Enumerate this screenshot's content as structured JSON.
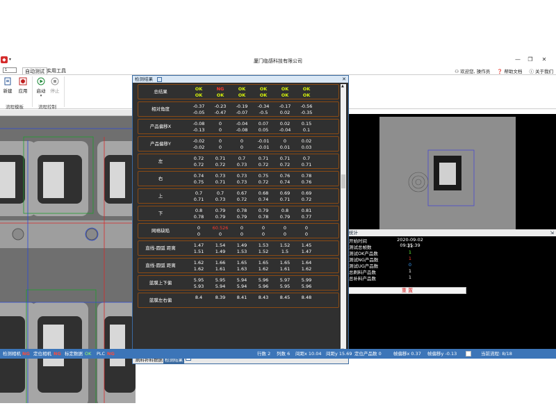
{
  "window": {
    "title": "厦门临感科技有限公司",
    "min": "—",
    "restore": "❐",
    "close": "✕"
  },
  "app_icon": "logo-icon",
  "menu": {
    "combo_value": "1",
    "tabs": [
      "自动测试",
      "实用工具"
    ],
    "user": {
      "welcome": "欢迎您, 操作员",
      "help": "帮助文档",
      "about": "关于我们"
    }
  },
  "ribbon": {
    "groups": [
      {
        "label": "流程模板",
        "buttons": [
          "新建",
          "应用"
        ]
      },
      {
        "label": "流程控制",
        "buttons": [
          "启动",
          "停止"
        ]
      }
    ]
  },
  "results": {
    "title": "检测结果",
    "summary": {
      "label": "总结果",
      "line1": [
        "OK",
        "NG",
        "OK",
        "OK",
        "OK",
        "OK"
      ],
      "line2": [
        "OK",
        "OK",
        "OK",
        "OK",
        "OK",
        "OK"
      ]
    },
    "rows": [
      {
        "label": "相对角度",
        "line1": [
          "-0.37",
          "-0.23",
          "-0.19",
          "-0.34",
          "-0.17",
          "-0.56"
        ],
        "line2": [
          "-0.05",
          "-0.47",
          "-0.07",
          "-0.5",
          "0.02",
          "-0.35"
        ]
      },
      {
        "label": "产品偏移X",
        "line1": [
          "-0.08",
          "0",
          "-0.04",
          "0.07",
          "0.02",
          "0.15"
        ],
        "line2": [
          "-0.13",
          "0",
          "-0.08",
          "0.05",
          "-0.04",
          "0.1"
        ]
      },
      {
        "label": "产品偏移Y",
        "line1": [
          "-0.02",
          "0",
          "0",
          "-0.01",
          "0",
          "0.02"
        ],
        "line2": [
          "-0.02",
          "0",
          "0",
          "-0.01",
          "0.01",
          "0.03"
        ]
      },
      {
        "label": "左",
        "line1": [
          "0.72",
          "0.71",
          "0.7",
          "0.71",
          "0.71",
          "0.7"
        ],
        "line2": [
          "0.72",
          "0.72",
          "0.73",
          "0.72",
          "0.72",
          "0.71"
        ]
      },
      {
        "label": "右",
        "line1": [
          "0.74",
          "0.73",
          "0.73",
          "0.75",
          "0.76",
          "0.78"
        ],
        "line2": [
          "0.75",
          "0.71",
          "0.73",
          "0.72",
          "0.74",
          "0.76"
        ]
      },
      {
        "label": "上",
        "line1": [
          "0.7",
          "0.7",
          "0.67",
          "0.68",
          "0.69",
          "0.69"
        ],
        "line2": [
          "0.71",
          "0.73",
          "0.72",
          "0.74",
          "0.71",
          "0.72"
        ]
      },
      {
        "label": "下",
        "line1": [
          "0.8",
          "0.79",
          "0.78",
          "0.79",
          "0.8",
          "0.81"
        ],
        "line2": [
          "0.78",
          "0.79",
          "0.79",
          "0.78",
          "0.79",
          "0.77"
        ]
      },
      {
        "label": "网格缺陷",
        "line1": [
          "0",
          "60.526",
          "0",
          "0",
          "0",
          "0"
        ],
        "line2": [
          "0",
          "0",
          "0",
          "0",
          "0",
          "0"
        ],
        "red": "60.526"
      },
      {
        "label": "直线-圆弧 距离",
        "line1": [
          "1.47",
          "1.54",
          "1.49",
          "1.53",
          "1.52",
          "1.45"
        ],
        "line2": [
          "1.51",
          "1.49",
          "1.53",
          "1.52",
          "1.5",
          "1.47"
        ]
      },
      {
        "label": "直线-圆弧 距离",
        "line1": [
          "1.62",
          "1.66",
          "1.65",
          "1.65",
          "1.65",
          "1.64"
        ],
        "line2": [
          "1.62",
          "1.61",
          "1.63",
          "1.62",
          "1.61",
          "1.62"
        ]
      },
      {
        "label": "蓝膜上下偏",
        "line1": [
          "5.95",
          "5.95",
          "5.94",
          "5.96",
          "5.97",
          "5.99"
        ],
        "line2": [
          "5.93",
          "5.94",
          "5.94",
          "5.96",
          "5.95",
          "5.96"
        ]
      },
      {
        "label": "蓝膜左右偏",
        "line1": [
          "8.4",
          "8.39",
          "8.41",
          "8.43",
          "8.45",
          "8.48"
        ],
        "line2": []
      }
    ],
    "tabs": [
      "刷料补料数据",
      "检测结果"
    ]
  },
  "stats": {
    "title": "统计",
    "rows": [
      {
        "key": "开始时间",
        "value": "2020-09-02 09:35:39",
        "color": "#ffffff"
      },
      {
        "key": "测试总帧数",
        "value": "11",
        "color": "#ffffff"
      },
      {
        "key": "测试OK产品数",
        "value": "1",
        "color": "#6aff3a"
      },
      {
        "key": "测试NG产品数",
        "value": "1",
        "color": "#ff3b2f"
      },
      {
        "key": "测试UG产品数",
        "value": "0",
        "color": "#3aa0ff"
      },
      {
        "key": "总刷料产品数",
        "value": "1",
        "color": "#ffffff"
      },
      {
        "key": "总补料产品数",
        "value": "1",
        "color": "#ffffff"
      }
    ],
    "reset_label": "重 置"
  },
  "status": {
    "det_cam_label": "检测相机",
    "det_cam_val": "NG",
    "pos_cam_label": "定位相机",
    "pos_cam_val": "NG",
    "calib_label": "标定数据",
    "calib_val": "OK",
    "plc_label": "PLC",
    "plc_val": "NG",
    "rows": "行数 2",
    "cols": "列数 6",
    "pitch_x": "间距x 10.04",
    "pitch_y": "间距y 15.69",
    "pos_count": "定位产品数 0",
    "offset_x": "帧偏移x 0.37",
    "offset_y": "帧偏移y -0.13",
    "progress": "当前流程: 8/18"
  }
}
